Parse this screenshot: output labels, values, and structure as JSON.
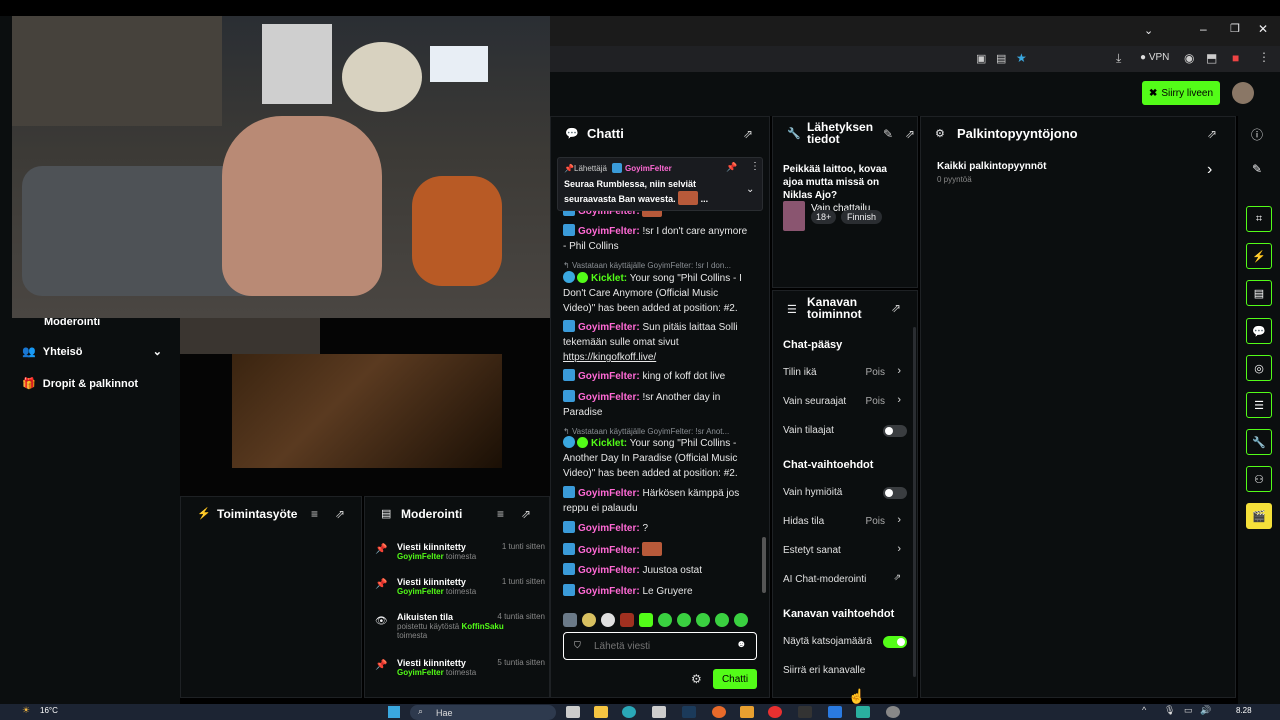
{
  "browser": {
    "vpn_label": "VPN",
    "go_live": "Siirry liveen"
  },
  "sidebar": {
    "items": [
      {
        "label": "Moderointi"
      },
      {
        "label": "Yhteisö"
      },
      {
        "label": "Dropit & palkinnot"
      }
    ]
  },
  "activity": {
    "title": "Toimintasyöte"
  },
  "moderation": {
    "title": "Moderointi",
    "entries": [
      {
        "title": "Viesti kiinnitetty",
        "time": "1 tunti sitten",
        "user": "GoyimFelter",
        "suffix": "toimesta"
      },
      {
        "title": "Viesti kiinnitetty",
        "time": "1 tunti sitten",
        "user": "GoyimFelter",
        "suffix": "toimesta"
      },
      {
        "title": "Aikuisten tila",
        "time": "4 tuntia sitten",
        "prefix": "poistettu käytöstä",
        "user": "KoffinSaku",
        "suffix": "toimesta"
      },
      {
        "title": "Viesti kiinnitetty",
        "time": "5 tuntia sitten",
        "user": "GoyimFelter",
        "suffix": "toimesta"
      }
    ]
  },
  "chat": {
    "title": "Chatti",
    "pinned": {
      "by_label": "Lähettäjä",
      "user": "GoyimFelter",
      "text": "Seuraa Rumblessa, niin selviät seuraavasta Ban wavesta.",
      "tail": "..."
    },
    "messages": [
      {
        "user": "GoyimFelter",
        "text": ""
      },
      {
        "user": "GoyimFelter",
        "text": "!sr I don't care anymore - Phil Collins"
      },
      {
        "reply": "Vastataan käyttäjälle GoyimFelter: !sr I don..."
      },
      {
        "user": "Kicklet",
        "text": "Your song \"Phil Collins - I Don't Care Anymore (Official Music Video)\" has been added at position: #2."
      },
      {
        "user": "GoyimFelter",
        "text": "Sun pitäis laittaa Solli tekemään sulle omat sivut",
        "link": "https://kingofkoff.live/"
      },
      {
        "user": "GoyimFelter",
        "text": "king of koff dot live"
      },
      {
        "user": "GoyimFelter",
        "text": "!sr Another day in Paradise"
      },
      {
        "reply": "Vastataan käyttäjälle GoyimFelter: !sr Anot..."
      },
      {
        "user": "Kicklet",
        "text": "Your song \"Phil Collins - Another Day In Paradise (Official Music Video)\" has been added at position: #2."
      },
      {
        "user": "GoyimFelter",
        "text": "Härkösen kämppä jos reppu ei palaudu"
      },
      {
        "user": "GoyimFelter",
        "text": "?"
      },
      {
        "user": "GoyimFelter",
        "text": ""
      },
      {
        "user": "GoyimFelter",
        "text": "Juustoa ostat"
      },
      {
        "user": "GoyimFelter",
        "text": "Le Gruyere"
      }
    ],
    "input_placeholder": "Lähetä viesti",
    "send_label": "Chatti"
  },
  "stream_info": {
    "title_line1": "Lähetyksen",
    "title_line2": "tiedot",
    "stream_title": "Peikkää laittoo, kovaa ajoa mutta missä on Niklas Ajo?",
    "category": "Vain chattailu",
    "tags": [
      "18+",
      "Finnish"
    ]
  },
  "actions": {
    "title_line1": "Kanavan",
    "title_line2": "toiminnot",
    "chat_access": "Chat-pääsy",
    "account_age": "Tilin ikä",
    "account_age_val": "Pois",
    "followers_only": "Vain seuraajat",
    "followers_only_val": "Pois",
    "subs_only": "Vain tilaajat",
    "chat_options": "Chat-vaihtoehdot",
    "emotes_only": "Vain hymiöitä",
    "slow_mode": "Hidas tila",
    "slow_mode_val": "Pois",
    "banned_words": "Estetyt sanat",
    "ai_mod": "AI Chat-moderointi",
    "channel_options": "Kanavan vaihtoehdot",
    "show_viewers": "Näytä katsojamäärä",
    "host": "Siirrä eri kanavalle"
  },
  "rewards": {
    "title": "Palkintopyyntöjono",
    "all": "Kaikki palkintopyynnöt",
    "count": "0 pyyntöä"
  },
  "taskbar": {
    "weather": "16°C",
    "search": "Hae",
    "time": "8.28"
  },
  "colors": {
    "accent": "#53fc18",
    "bg": "#0b0e0f",
    "kick_blue": "#3a9bd9"
  }
}
